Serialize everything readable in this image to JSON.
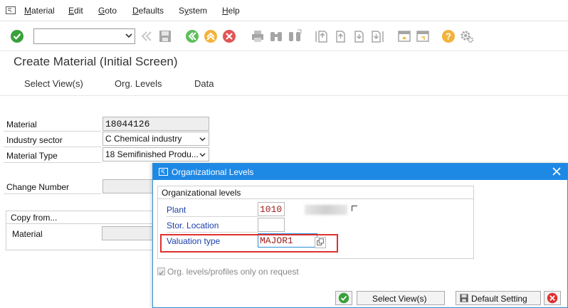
{
  "menu": {
    "items": [
      {
        "pre": "",
        "u": "M",
        "post": "aterial"
      },
      {
        "pre": "",
        "u": "E",
        "post": "dit"
      },
      {
        "pre": "",
        "u": "G",
        "post": "oto"
      },
      {
        "pre": "",
        "u": "D",
        "post": "efaults"
      },
      {
        "pre": "S",
        "u": "y",
        "post": "stem"
      },
      {
        "pre": "",
        "u": "H",
        "post": "elp"
      }
    ]
  },
  "screen": {
    "title": "Create Material (Initial Screen)",
    "app_buttons": [
      "Select View(s)",
      "Org. Levels",
      "Data"
    ]
  },
  "form": {
    "material_label": "Material",
    "material_value": "18044126",
    "industry_label": "Industry sector",
    "industry_value": "C Chemical industry",
    "mattype_label": "Material Type",
    "mattype_value": "18 Semifinished Produ...",
    "change_label": "Change Number",
    "copy_title": "Copy from...",
    "copy_material_label": "Material"
  },
  "dialog": {
    "title": "Organizational Levels",
    "group_title": "Organizational levels",
    "plant_label": "Plant",
    "plant_value": "1010",
    "storloc_label": "Stor. Location",
    "valtype_label": "Valuation type",
    "valtype_value": "MAJOR1",
    "checkbox_label": "Org. levels/profiles only on request",
    "select_views_label": "Select View(s)",
    "default_setting_label": "Default Setting"
  },
  "colors": {
    "dialog_title_bg": "#1e88e5",
    "highlight": "#e03030",
    "field_value": "#a01c1c"
  }
}
